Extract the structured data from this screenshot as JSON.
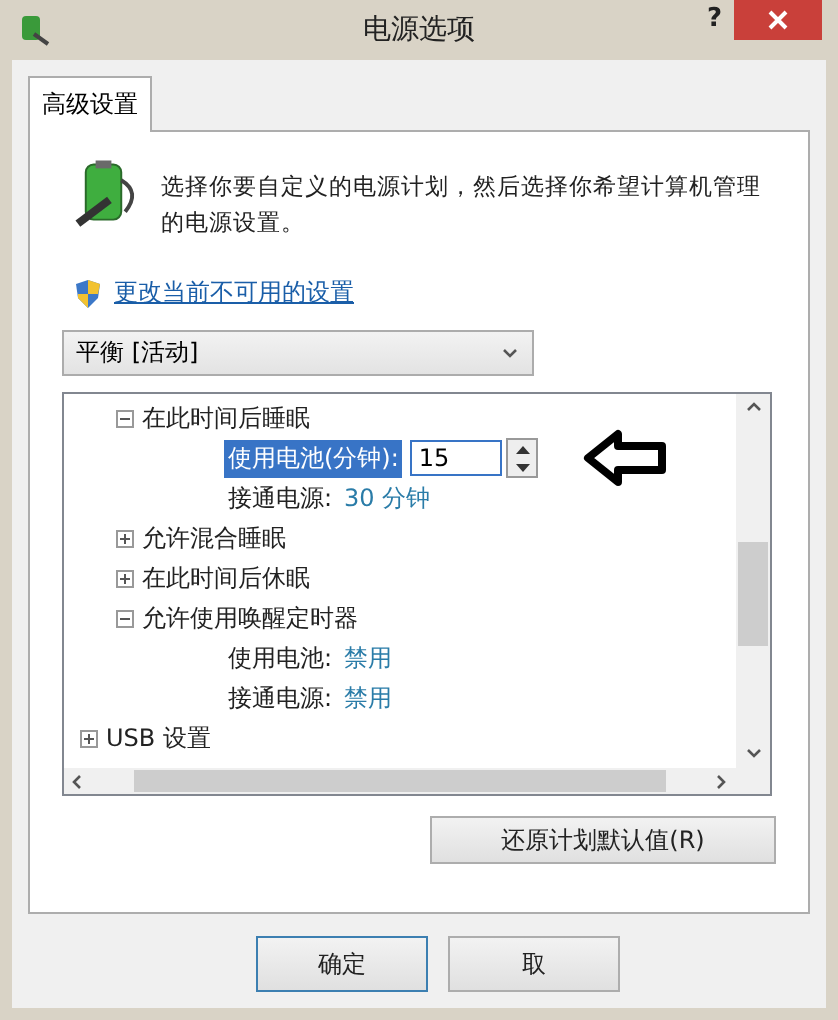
{
  "window": {
    "title": "电源选项",
    "help": "?"
  },
  "tabs": [
    {
      "label": "高级设置",
      "selected": true
    }
  ],
  "intro": "选择你要自定义的电源计划，然后选择你希望计算机管理的电源设置。",
  "link": "更改当前不可用的设置",
  "plan_select": {
    "value": "平衡 [活动]"
  },
  "tree": {
    "items": [
      {
        "children": [
          {
            "label": "在此时间后睡眠",
            "expanded": true,
            "children": [
              {
                "kind": "spin",
                "label": "使用电池(分钟):",
                "value": "15",
                "selected": true
              },
              {
                "kind": "setting",
                "label": "接通电源:",
                "value": "30 分钟",
                "selected": false
              }
            ]
          },
          {
            "label": "允许混合睡眠",
            "expanded": false
          },
          {
            "label": "在此时间后休眠",
            "expanded": false
          },
          {
            "label": "允许使用唤醒定时器",
            "expanded": true,
            "children": [
              {
                "kind": "setting",
                "label": "使用电池:",
                "value": "禁用",
                "selected": false
              },
              {
                "kind": "setting",
                "label": "接通电源:",
                "value": "禁用",
                "selected": false
              }
            ]
          }
        ]
      },
      {
        "label": "USB 设置",
        "expanded": false
      }
    ]
  },
  "restore_button": "还原计划默认值(R)",
  "buttons": [
    {
      "label": "确定",
      "default": true
    },
    {
      "label": "取",
      "default": false
    }
  ]
}
